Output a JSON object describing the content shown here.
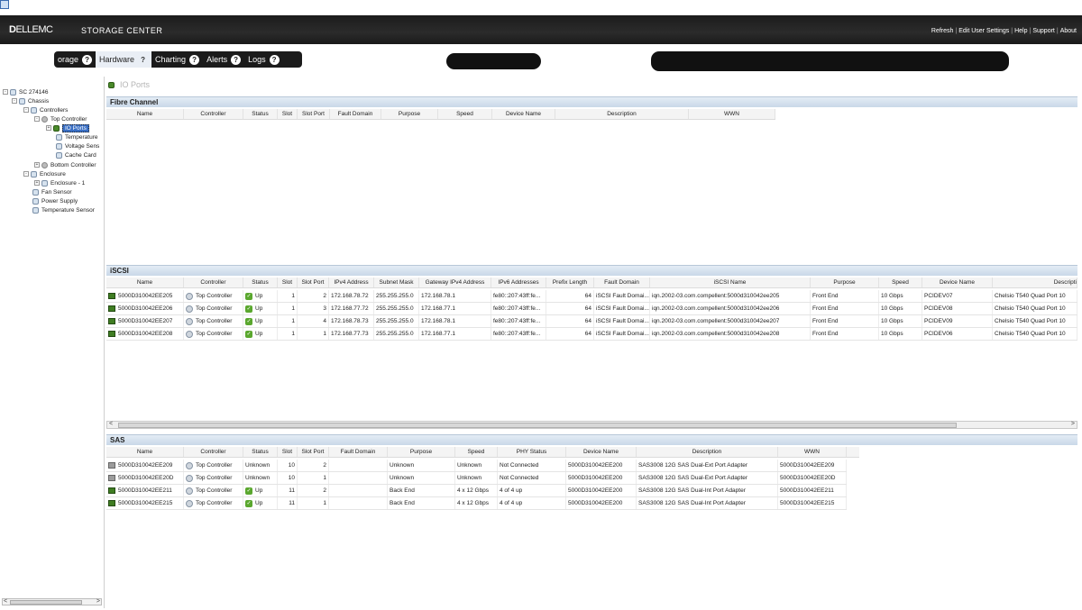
{
  "header": {
    "logo_bold": "D",
    "logo_text": "ELLEMC",
    "product": "STORAGE CENTER",
    "links": [
      "Refresh",
      "Edit User Settings",
      "Help",
      "Support",
      "About"
    ]
  },
  "nav": {
    "tabs": [
      {
        "label": "orage",
        "active": false
      },
      {
        "label": "Hardware",
        "active": true
      },
      {
        "label": "Charting",
        "active": false
      },
      {
        "label": "Alerts",
        "active": false
      },
      {
        "label": "Logs",
        "active": false
      }
    ],
    "help_glyph": "?"
  },
  "tree": {
    "items": [
      "SC 274146",
      "Chassis",
      "Controllers",
      "Top Controller",
      "IO Ports",
      "Temperature",
      "Voltage Sens",
      "Cache Card",
      "Bottom Controller",
      "Enclosure",
      "Enclosure - 1",
      "Fan Sensor",
      "Power Supply",
      "Temperature Sensor"
    ]
  },
  "page": {
    "title": "IO Ports"
  },
  "fibre_channel": {
    "title": "Fibre Channel",
    "columns": [
      "Name",
      "Controller",
      "Status",
      "Slot",
      "Slot Port",
      "Fault Domain",
      "Purpose",
      "Speed",
      "Device Name",
      "Description",
      "WWN"
    ]
  },
  "iscsi": {
    "title": "iSCSI",
    "columns": [
      "Name",
      "Controller",
      "Status",
      "Slot",
      "Slot Port",
      "IPv4 Address",
      "Subnet Mask",
      "Gateway IPv4 Address",
      "IPv6 Addresses",
      "Prefix Length",
      "Fault Domain",
      "iSCSI Name",
      "Purpose",
      "Speed",
      "Device Name",
      "Descripti"
    ],
    "rows": [
      [
        "5000D310042EE205",
        "Top Controller",
        "Up",
        "1",
        "2",
        "172.168.78.72",
        "255.255.255.0",
        "172.168.78.1",
        "fe80::207:43ff:fe...",
        "64",
        "iSCSI Fault Domai...",
        "iqn.2002-03.com.compellent:5000d310042ee205",
        "Front End",
        "10 Gbps",
        "PCIDEV07",
        "Chelsio T540 Quad Port 10"
      ],
      [
        "5000D310042EE206",
        "Top Controller",
        "Up",
        "1",
        "3",
        "172.168.77.72",
        "255.255.255.0",
        "172.168.77.1",
        "fe80::207:43ff:fe...",
        "64",
        "iSCSI Fault Domai...",
        "iqn.2002-03.com.compellent:5000d310042ee206",
        "Front End",
        "10 Gbps",
        "PCIDEV08",
        "Chelsio T540 Quad Port 10"
      ],
      [
        "5000D310042EE207",
        "Top Controller",
        "Up",
        "1",
        "4",
        "172.168.78.73",
        "255.255.255.0",
        "172.168.78.1",
        "fe80::207:43ff:fe...",
        "64",
        "iSCSI Fault Domai...",
        "iqn.2002-03.com.compellent:5000d310042ee207",
        "Front End",
        "10 Gbps",
        "PCIDEV09",
        "Chelsio T540 Quad Port 10"
      ],
      [
        "5000D310042EE208",
        "Top Controller",
        "Up",
        "1",
        "1",
        "172.168.77.73",
        "255.255.255.0",
        "172.168.77.1",
        "fe80::207:43ff:fe...",
        "64",
        "iSCSI Fault Domai...",
        "iqn.2002-03.com.compellent:5000d310042ee208",
        "Front End",
        "10 Gbps",
        "PCIDEV06",
        "Chelsio T540 Quad Port 10"
      ]
    ]
  },
  "sas": {
    "title": "SAS",
    "columns": [
      "Name",
      "Controller",
      "Status",
      "Slot",
      "Slot Port",
      "Fault Domain",
      "Purpose",
      "Speed",
      "PHY Status",
      "Device Name",
      "Description",
      "WWN"
    ],
    "rows": [
      [
        "5000D310042EE209",
        "Top Controller",
        "Unknown",
        "10",
        "2",
        "",
        "Unknown",
        "Unknown",
        "Not Connected",
        "5000D310042EE200",
        "SAS3008 12G SAS Dual-Ext Port Adapter",
        "5000D310042EE209"
      ],
      [
        "5000D310042EE20D",
        "Top Controller",
        "Unknown",
        "10",
        "1",
        "",
        "Unknown",
        "Unknown",
        "Not Connected",
        "5000D310042EE200",
        "SAS3008 12G SAS Dual-Ext Port Adapter",
        "5000D310042EE20D"
      ],
      [
        "5000D310042EE211",
        "Top Controller",
        "Up",
        "11",
        "2",
        "",
        "Back End",
        "4 x 12 Gbps",
        "4 of 4 up",
        "5000D310042EE200",
        "SAS3008 12G SAS Dual-Int Port Adapter",
        "5000D310042EE211"
      ],
      [
        "5000D310042EE215",
        "Top Controller",
        "Up",
        "11",
        "1",
        "",
        "Back End",
        "4 x 12 Gbps",
        "4 of 4 up",
        "5000D310042EE200",
        "SAS3008 12G SAS Dual-Int Port Adapter",
        "5000D310042EE215"
      ]
    ],
    "port_status_icons": [
      "gray",
      "gray",
      "green",
      "green"
    ]
  },
  "scroll_arrows": {
    "left": "<",
    "right": ">"
  }
}
